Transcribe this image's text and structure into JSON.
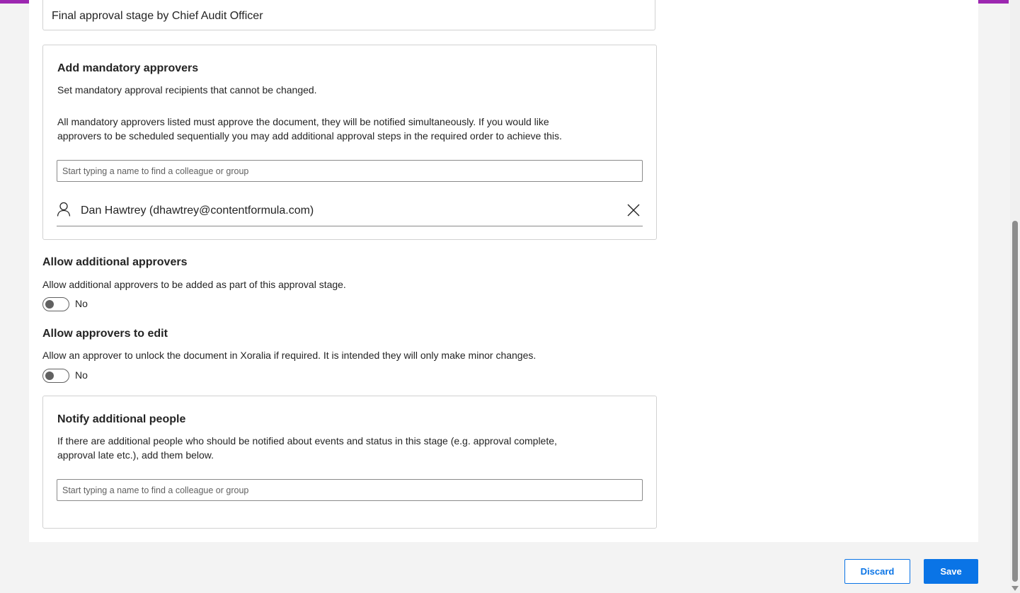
{
  "colors": {
    "accent_bar": "#9c27b0",
    "primary": "#0a74e6"
  },
  "stage": {
    "name_value": "Final approval stage by Chief Audit Officer"
  },
  "mandatory_approvers": {
    "title": "Add mandatory approvers",
    "subtitle": "Set mandatory approval recipients that cannot be changed.",
    "description_line1": "All mandatory approvers listed must approve the document, they will be notified simultaneously. If you would like",
    "description_line2": "approvers to be scheduled sequentially you may add additional approval steps in the required order to achieve this.",
    "search_placeholder": "Start typing a name to find a colleague or group",
    "approvers": [
      {
        "name": "Dan Hawtrey (dhawtrey@contentformula.com)",
        "icon": "person-icon",
        "remove_icon": "close-icon"
      }
    ]
  },
  "additional_approvers": {
    "title": "Allow additional approvers",
    "description": "Allow additional approvers to be added as part of this approval stage.",
    "toggle_on": false,
    "toggle_label": "No"
  },
  "approvers_edit": {
    "title": "Allow approvers to edit",
    "description": "Allow an approver to unlock the document in Xoralia if required. It is intended they will only make minor changes.",
    "toggle_on": false,
    "toggle_label": "No"
  },
  "notify_people": {
    "title": "Notify additional people",
    "description_line1": "If there are additional people who should be notified about events and status in this stage (e.g. approval complete,",
    "description_line2": "approval late etc.), add them below.",
    "search_placeholder": "Start typing a name to find a colleague or group"
  },
  "actions": {
    "discard_label": "Discard",
    "save_label": "Save"
  }
}
